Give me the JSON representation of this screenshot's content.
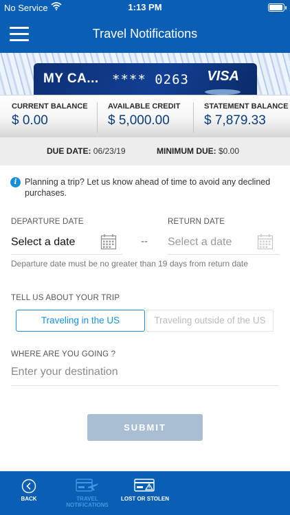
{
  "status_bar": {
    "carrier": "No Service",
    "time": "1:13 PM"
  },
  "nav": {
    "title": "Travel Notifications",
    "menu_icon": "hamburger-menu-icon"
  },
  "card": {
    "name": "MY CA...",
    "masked": "****",
    "last4": "0263",
    "brand": "VISA"
  },
  "balances": [
    {
      "label": "CURRENT BALANCE",
      "value": "$ 0.00"
    },
    {
      "label": "AVAILABLE CREDIT",
      "value": "$ 5,000.00"
    },
    {
      "label": "STATEMENT BALANCE",
      "value": "$ 7,879.33"
    }
  ],
  "due": {
    "date_label": "DUE DATE:",
    "date_value": "06/23/19",
    "min_label": "MINIMUM DUE:",
    "min_value": "$0.00"
  },
  "notice": {
    "text": "Planning a trip? Let us know ahead of time to avoid any declined purchases."
  },
  "dates": {
    "departure_label": "DEPARTURE DATE",
    "departure_value": "Select a date",
    "return_label": "RETURN DATE",
    "return_value": "Select a date",
    "separator": "--",
    "hint": "Departure date must be no greater than 19 days from return date"
  },
  "trip": {
    "label": "TELL US ABOUT YOUR TRIP",
    "options": [
      "Traveling in the US",
      "Traveling outside of the US"
    ],
    "selected": "Traveling in the US"
  },
  "destination": {
    "label": "WHERE ARE YOU GOING ?",
    "placeholder": "Enter your destination"
  },
  "submit_label": "SUBMIT",
  "tabs": [
    {
      "label": "BACK",
      "icon": "back-circle-icon"
    },
    {
      "label": "TRAVEL NOTIFICATIONS",
      "icon": "card-airplane-icon",
      "active": true
    },
    {
      "label": "LOST OR STOLEN",
      "icon": "card-alert-icon"
    }
  ],
  "colors": {
    "primary": "#0a5fb4",
    "accent": "#1a8fd8",
    "submit_disabled": "#a9bdd3",
    "value_text": "#0a3c7a"
  }
}
